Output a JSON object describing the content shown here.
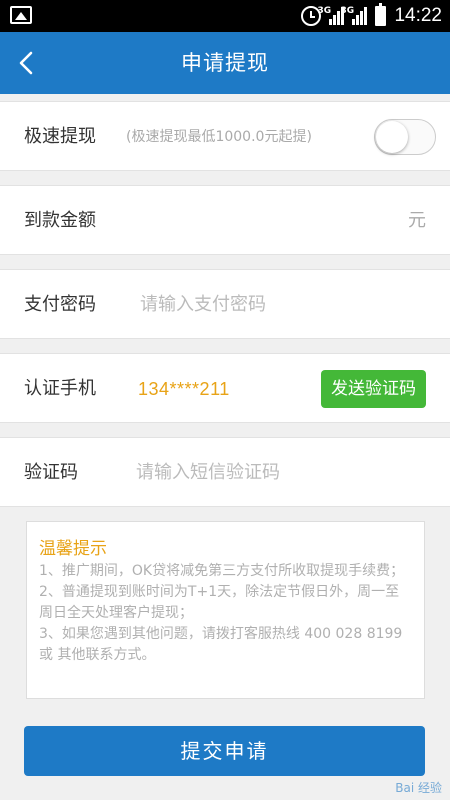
{
  "status_bar": {
    "time": "14:22",
    "network_1": "3G",
    "network_2": "3G"
  },
  "header": {
    "title": "申请提现"
  },
  "form": {
    "fast_withdraw": {
      "label": "极速提现",
      "hint": "(极速提现最低1000.0元起提)",
      "enabled": false
    },
    "amount": {
      "label": "到款金额",
      "unit": "元"
    },
    "pay_password": {
      "label": "支付密码",
      "placeholder": "请输入支付密码"
    },
    "phone": {
      "label": "认证手机",
      "value": "134****211",
      "send_button": "发送验证码"
    },
    "sms_code": {
      "label": "验证码",
      "placeholder": "请输入短信验证码"
    }
  },
  "tips": {
    "title": "温馨提示",
    "items": [
      "1、推广期间，OK贷将减免第三方支付所收取提现手续费；",
      "2、普通提现到账时间为T+1天，除法定节假日外，周一至周日全天处理客户提现；",
      "3、如果您遇到其他问题，请拨打客服热线 400 028 8199 或 其他联系方式。"
    ]
  },
  "submit": {
    "label": "提交申请"
  },
  "watermark": "Bai 经验",
  "colors": {
    "primary": "#1e7ac6",
    "accent_orange": "#e8a317",
    "send_green": "#44b838"
  }
}
